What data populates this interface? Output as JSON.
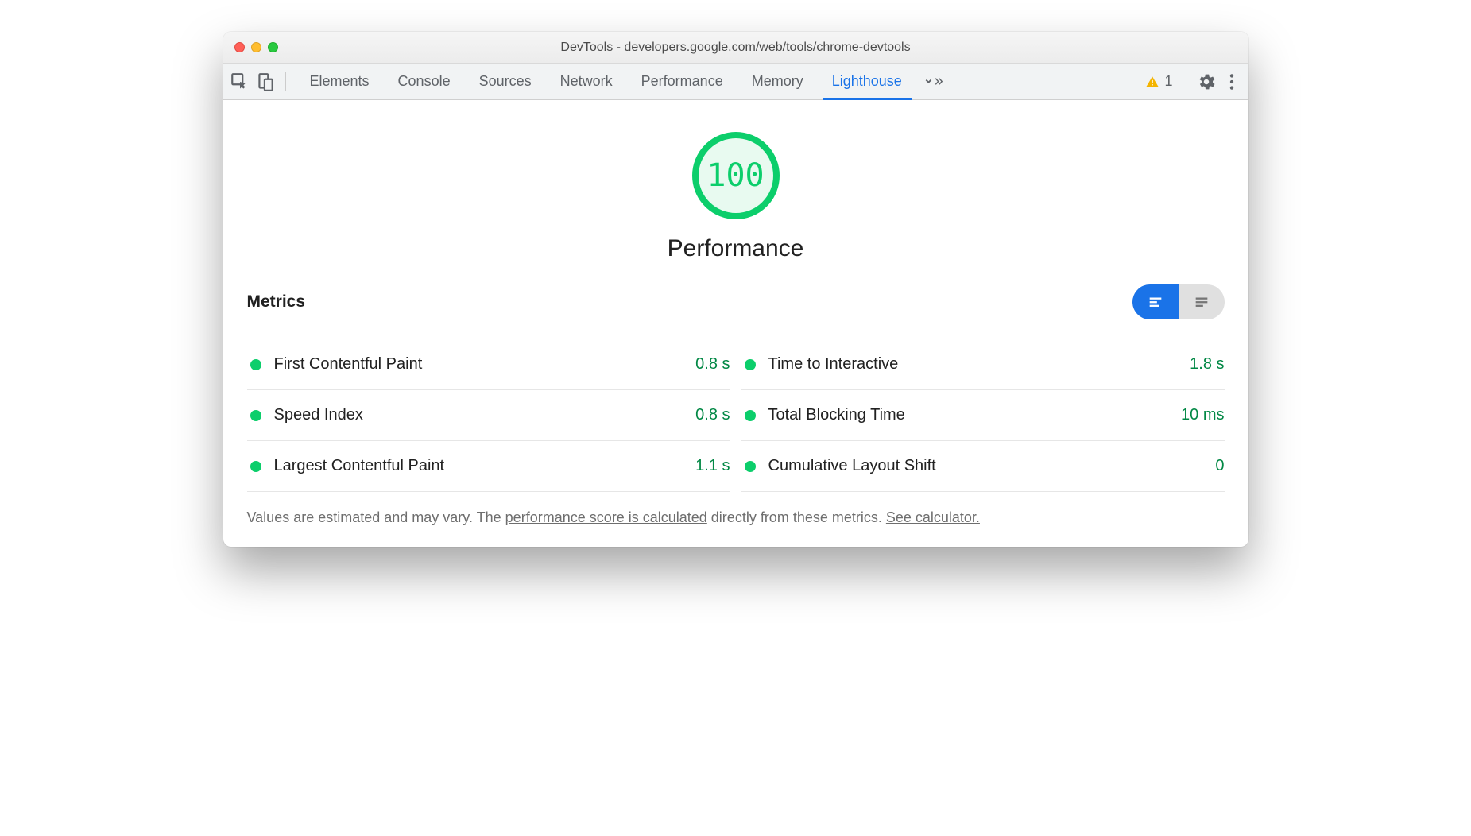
{
  "window": {
    "title": "DevTools - developers.google.com/web/tools/chrome-devtools"
  },
  "toolbar": {
    "tabs": [
      "Elements",
      "Console",
      "Sources",
      "Network",
      "Performance",
      "Memory",
      "Lighthouse"
    ],
    "active_tab": "Lighthouse",
    "warning_count": "1"
  },
  "report": {
    "score": "100",
    "category": "Performance",
    "metrics_label": "Metrics",
    "metrics": [
      {
        "label": "First Contentful Paint",
        "value": "0.8 s"
      },
      {
        "label": "Time to Interactive",
        "value": "1.8 s"
      },
      {
        "label": "Speed Index",
        "value": "0.8 s"
      },
      {
        "label": "Total Blocking Time",
        "value": "10 ms"
      },
      {
        "label": "Largest Contentful Paint",
        "value": "1.1 s"
      },
      {
        "label": "Cumulative Layout Shift",
        "value": "0"
      }
    ],
    "footer_pre": "Values are estimated and may vary. The ",
    "footer_link1": "performance score is calculated",
    "footer_mid": " directly from these metrics. ",
    "footer_link2": "See calculator."
  }
}
